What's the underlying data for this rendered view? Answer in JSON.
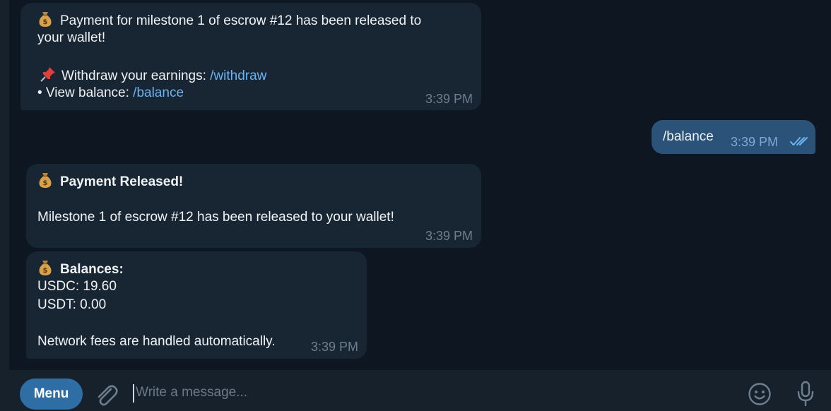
{
  "messages": [
    {
      "line1": "Payment for milestone 1 of escrow #12 has been released to",
      "line2": "your wallet!",
      "withdraw_label": "Withdraw your earnings: ",
      "withdraw_cmd": "/withdraw",
      "balance_label": "• View balance: ",
      "balance_cmd": "/balance",
      "time": "3:39 PM"
    },
    {
      "text": "/balance",
      "time": "3:39 PM",
      "read": true
    },
    {
      "title": "Payment Released!",
      "body": "Milestone 1 of escrow #12 has been released to your wallet!",
      "time": "3:39 PM"
    },
    {
      "title": "Balances:",
      "usdc": "USDC: 19.60",
      "usdt": "USDT: 0.00",
      "note": "Network fees are handled automatically.",
      "time": "3:39 PM"
    }
  ],
  "icons": {
    "money_bag": "money-bag-emoji",
    "pushpin": "pushpin-emoji",
    "read_receipt": "double-check-icon",
    "attach": "paperclip-icon",
    "emoji": "smiley-icon",
    "mic": "microphone-icon"
  },
  "compose": {
    "menu_label": "Menu",
    "placeholder": "Write a message..."
  },
  "colors": {
    "background": "#0e1621",
    "incoming_bubble": "#182533",
    "outgoing_bubble": "#2b5278",
    "link": "#6ab3f3",
    "menu_button": "#2f6ea5"
  }
}
